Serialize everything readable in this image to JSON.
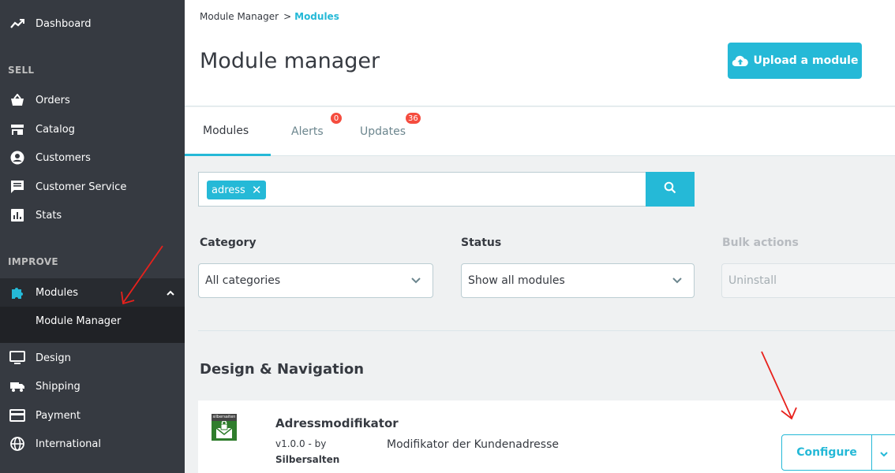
{
  "sidebar": {
    "dashboard": "Dashboard",
    "sell_title": "SELL",
    "orders": "Orders",
    "catalog": "Catalog",
    "customers": "Customers",
    "customer_service": "Customer Service",
    "stats": "Stats",
    "improve_title": "IMPROVE",
    "modules": "Modules",
    "module_manager": "Module Manager",
    "design": "Design",
    "shipping": "Shipping",
    "payment": "Payment",
    "international": "International"
  },
  "header": {
    "breadcrumb_parent": "Module Manager",
    "breadcrumb_sep": ">",
    "breadcrumb_current": "Modules",
    "title": "Module manager",
    "upload_label": "Upload a module"
  },
  "tabs": [
    {
      "label": "Modules"
    },
    {
      "label": "Alerts",
      "badge": "0"
    },
    {
      "label": "Updates",
      "badge": "36"
    }
  ],
  "search": {
    "tag": "adress",
    "tag_close": "✕"
  },
  "filters": {
    "category_label": "Category",
    "category_value": "All categories",
    "status_label": "Status",
    "status_value": "Show all modules",
    "bulk_label": "Bulk actions",
    "bulk_value": "Uninstall"
  },
  "section": {
    "title": "Design & Navigation"
  },
  "module": {
    "logo_text": "silbersaiten",
    "name": "Adressmodifikator",
    "version": "v1.0.0 - by",
    "author": "Silbersalten",
    "description": "Modifikator der Kundenadresse",
    "configure_label": "Configure"
  },
  "colors": {
    "accent": "#25b9d7",
    "sidebar": "#363a41",
    "badge": "#f54c3e",
    "annotation": "#e8211c"
  }
}
